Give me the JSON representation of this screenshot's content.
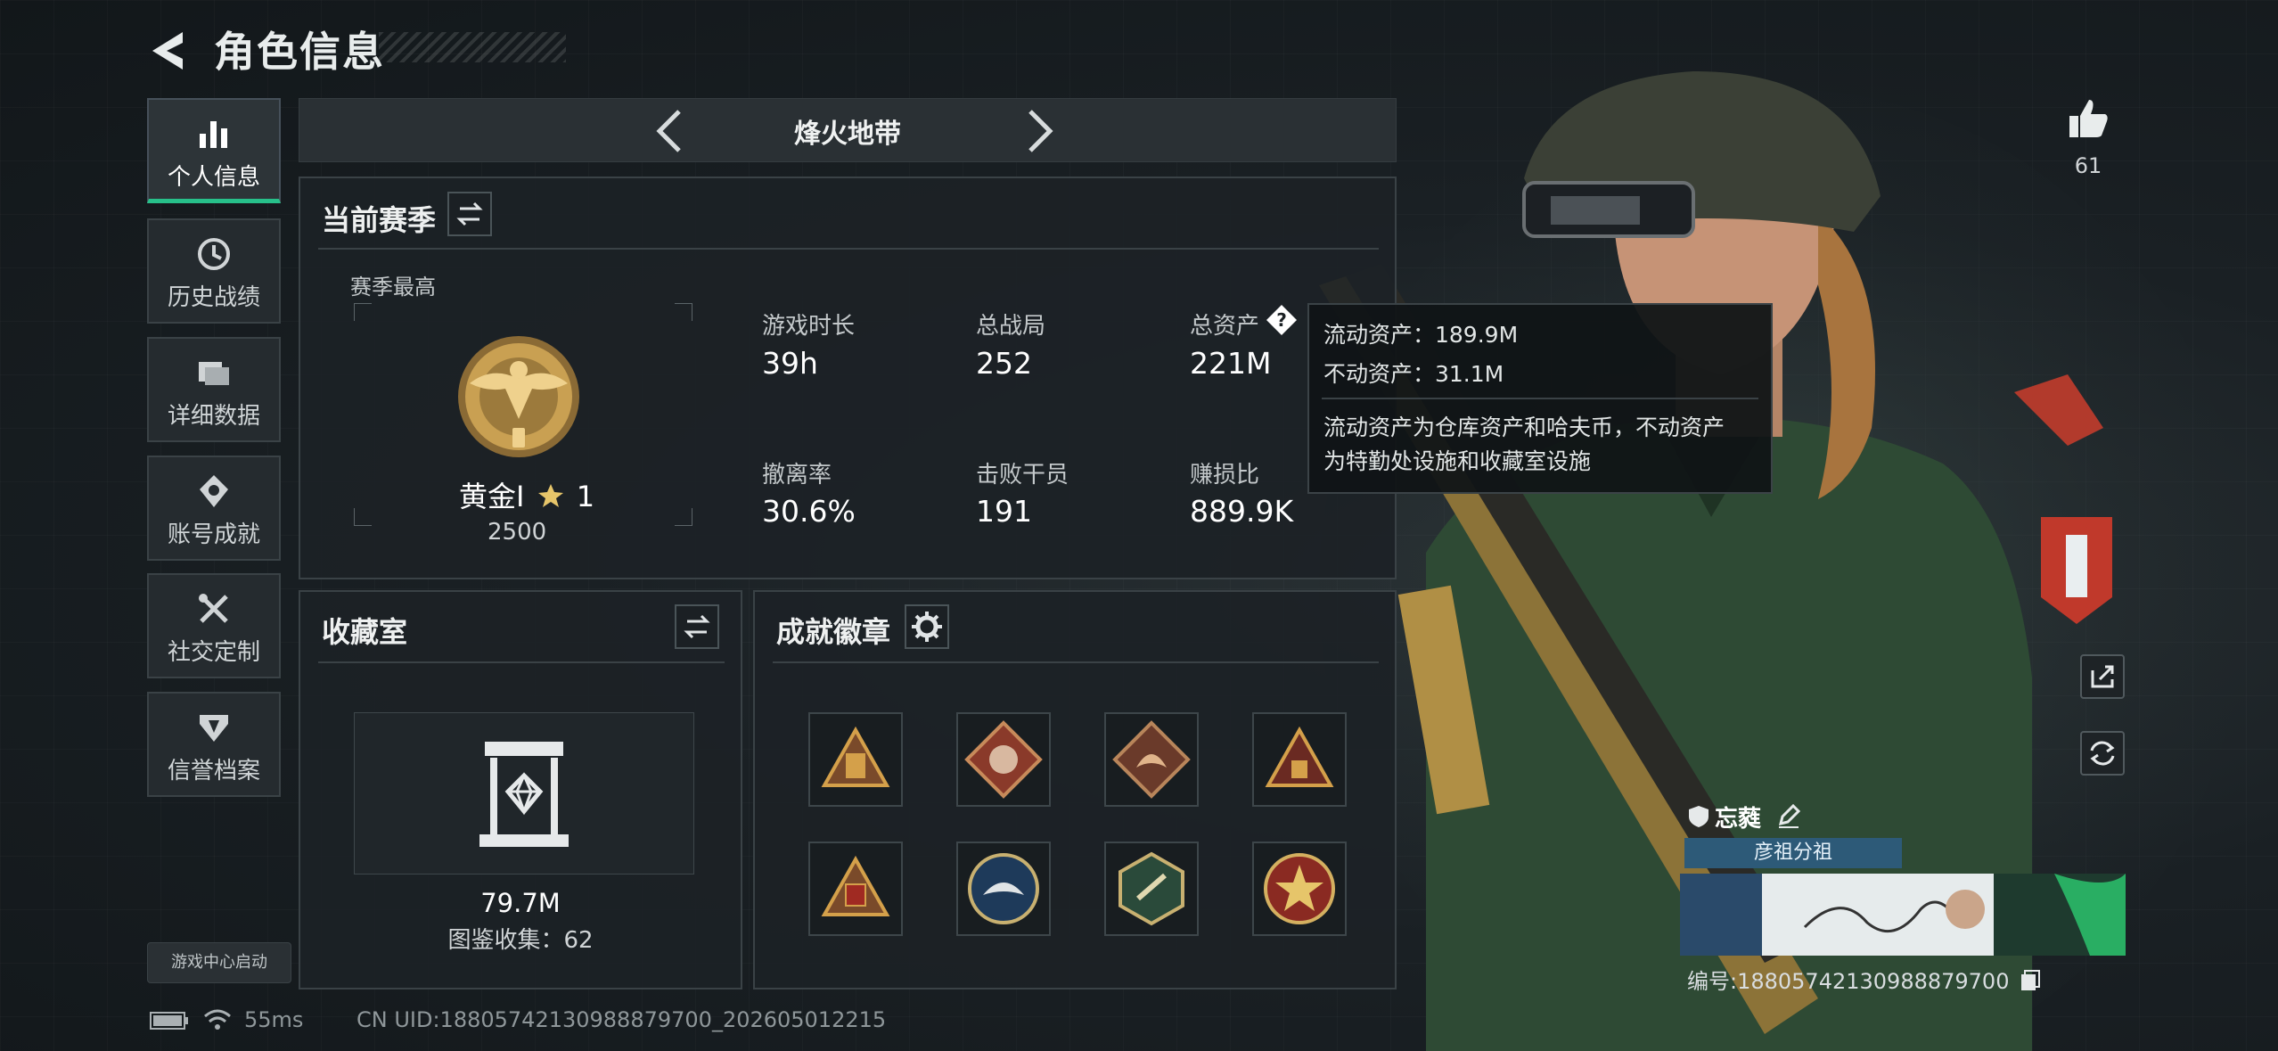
{
  "header": {
    "title": "角色信息"
  },
  "sidebar": {
    "items": [
      {
        "label": "个人信息",
        "icon": "bar-chart-icon",
        "active": true
      },
      {
        "label": "历史战绩",
        "icon": "clock-icon"
      },
      {
        "label": "详细数据",
        "icon": "folder-icon"
      },
      {
        "label": "账号成就",
        "icon": "achievement-icon"
      },
      {
        "label": "社交定制",
        "icon": "tools-icon"
      },
      {
        "label": "信誉档案",
        "icon": "shield-icon"
      }
    ],
    "launch": "游戏中心启动"
  },
  "mode": {
    "title": "烽火地带"
  },
  "season": {
    "title": "当前赛季",
    "best_label": "赛季最高",
    "rank_name": "黄金I",
    "rank_stars": "1",
    "rank_score": "2500",
    "stats": [
      {
        "label": "游戏时长",
        "value": "39h"
      },
      {
        "label": "总战局",
        "value": "252"
      },
      {
        "label": "总资产",
        "value": "221M"
      },
      {
        "label": "撤离率",
        "value": "30.6%"
      },
      {
        "label": "击败干员",
        "value": "191"
      },
      {
        "label": "赚损比",
        "value": "889.9K"
      }
    ]
  },
  "tooltip": {
    "line1": "流动资产：189.9M",
    "line2": "不动资产：31.1M",
    "line3": "流动资产为仓库资产和哈夫币，不动资产",
    "line4": "为特勤处设施和收藏室设施"
  },
  "collection": {
    "title": "收藏室",
    "value": "79.7M",
    "count_text": "图鉴收集：62"
  },
  "badges": {
    "title": "成就徽章",
    "items": [
      "badge-1",
      "badge-2",
      "badge-3",
      "badge-4",
      "badge-5",
      "badge-6",
      "badge-7",
      "badge-8"
    ]
  },
  "likes": {
    "count": "61"
  },
  "player": {
    "name": "忘蕤",
    "squad": "彦祖分祖",
    "serial": "编号:18805742130988879700"
  },
  "status": {
    "ping": "55ms",
    "uid": "CN UID:18805742130988879700_202605012215"
  },
  "colors": {
    "accent": "#27c08a",
    "gold": "#c9a052"
  }
}
